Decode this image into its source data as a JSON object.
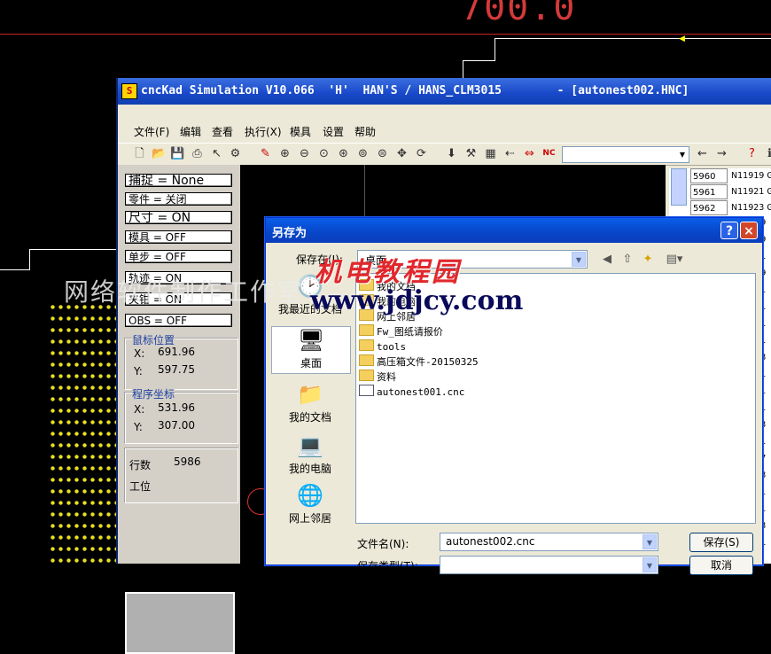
{
  "background": {
    "big_number": "700.0",
    "watermark": "网络软件制作工作室",
    "logo_text": "机电教程园",
    "logo_url": "www.jdjcy.com"
  },
  "window": {
    "icon": "S",
    "title": "cncKad Simulation V10.066  'H'  HAN'S / HANS_CLM3015        - [autonest002.HNC]"
  },
  "menu": [
    "文件(F)",
    "编辑",
    "查看",
    "执行(X)",
    "模具",
    "设置",
    "帮助"
  ],
  "toolbar_icons": [
    "new-icon",
    "open-icon",
    "save-icon",
    "print-icon",
    "help-pointer-icon",
    "tool-icon",
    "pen-icon",
    "zoom-in-icon",
    "zoom-out-icon",
    "zoom-window-icon",
    "zoom-all-icon",
    "zoom-prev-icon",
    "zoom-fit-icon",
    "pan-icon",
    "redraw-icon",
    "download-icon",
    "tool-table-icon",
    "grid-icon",
    "step-back-icon",
    "mirror-icon",
    "nc-icon",
    "walk-back-icon",
    "walk-forward-icon",
    "question-icon",
    "info-icon"
  ],
  "left_panel": {
    "toggles": [
      "捕捉 = None",
      "零件 = 关闭",
      "尺寸 = ON",
      "模具 = OFF",
      "单步 = OFF",
      "轨迹 = ON",
      "夹钳 = ON",
      "OBS = OFF"
    ],
    "mouse_pos": {
      "title": "鼠标位置",
      "x_label": "X:",
      "x": "691.96",
      "y_label": "Y:",
      "y": "597.75"
    },
    "program_pos": {
      "title": "程序坐标",
      "x_label": "X:",
      "x": "531.96",
      "y_label": "Y:",
      "y": "307.00"
    },
    "line_label": "行数",
    "line_value": "5986",
    "station_label": "工位"
  },
  "listing": [
    {
      "n": "5960",
      "code": "N11919 G"
    },
    {
      "n": "5961",
      "code": "N11921 G"
    },
    {
      "n": "5962",
      "code": "N11923 G"
    }
  ],
  "listing_digits": [
    "9",
    "9",
    "1",
    "9",
    "1",
    "1",
    "1",
    "1",
    "3",
    "1",
    "1",
    "1",
    "3",
    "1",
    "7",
    "3",
    "1",
    "1",
    "3",
    "1"
  ],
  "dialog": {
    "title": "另存为",
    "help": "?",
    "close": "×",
    "save_in_label": "保存在(I):",
    "save_in_value": "桌面",
    "places": [
      "我最近的文档",
      "桌面",
      "我的文档",
      "我的电脑",
      "网上邻居"
    ],
    "files": [
      "我的文档",
      "我的电脑",
      "网上邻居",
      "Fw_图纸请报价",
      "tools",
      "高压箱文件-20150325",
      "资料",
      "autonest001.cnc"
    ],
    "filename_label": "文件名(N):",
    "filename_value": "autonest002.cnc",
    "filetype_label": "保存类型(T):",
    "save_button": "保存(S)",
    "cancel_button": "取消"
  }
}
